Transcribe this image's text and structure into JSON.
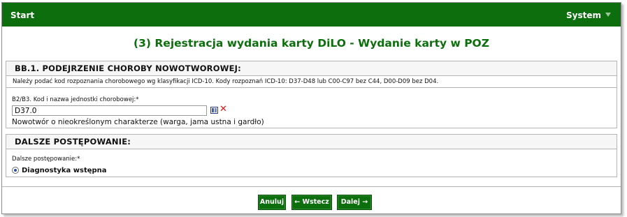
{
  "topbar": {
    "start": "Start",
    "system": "System"
  },
  "page_title": "(3) Rejestracja wydania karty DiLO - Wydanie karty w POZ",
  "section1": {
    "header": "BB.1. PODEJRZENIE CHOROBY NOWOTWOROWEJ:",
    "note": "Należy podać kod rozpoznania chorobowego wg klasyfikacji ICD-10. Kody rozpoznań ICD-10: D37-D48 lub C00-C97 bez C44, D00-D09 bez D04.",
    "field_label": "B2/B3. Kod i nazwa jednostki chorobowej:*",
    "field_value": "D37.0",
    "description": "Nowotwór o nieokreślonym charakterze (warga, jama ustna i gardło)",
    "clear_symbol": "✕"
  },
  "section2": {
    "header": "DALSZE POSTĘPOWANIE:",
    "field_label": "Dalsze postępowanie:*",
    "option_label": "Diagnostyka wstępna"
  },
  "buttons": {
    "cancel": "Anuluj",
    "back": "← Wstecz",
    "next": "Dalej →"
  },
  "colors": {
    "brand_green": "#0d6e0d",
    "clear_red": "#d11a1a"
  }
}
